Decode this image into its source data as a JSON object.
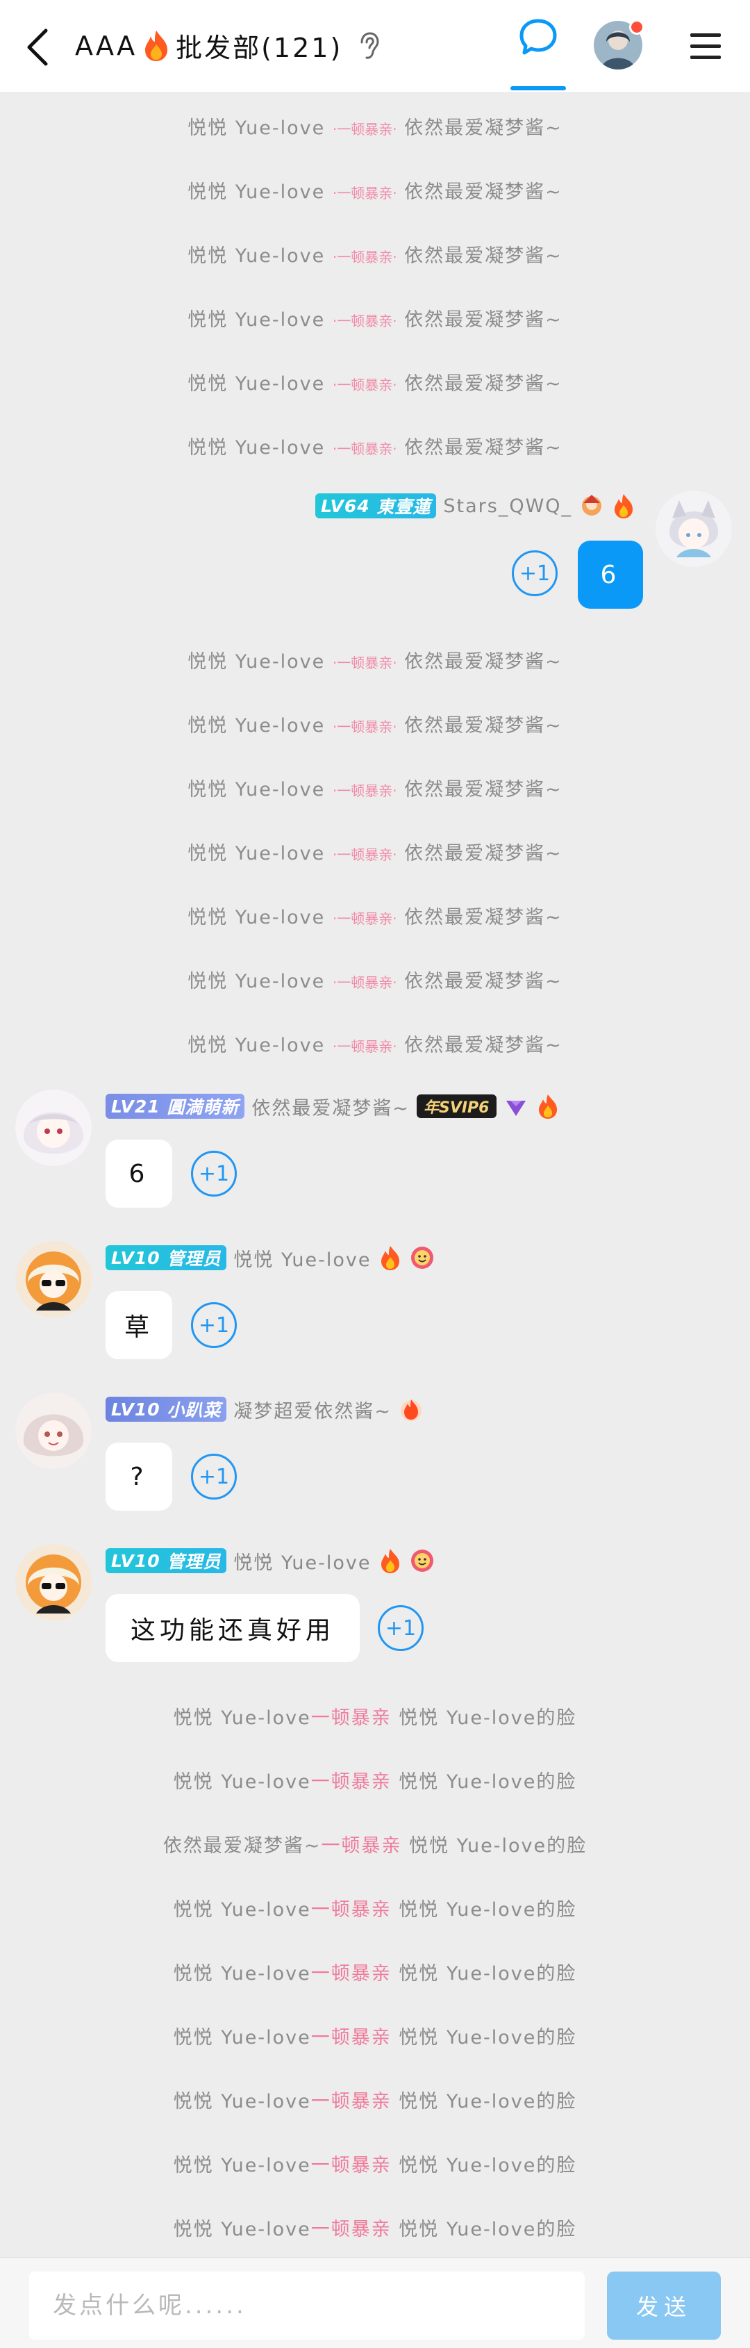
{
  "header": {
    "title_prefix": "AAA",
    "title_suffix": "批发部(121)",
    "icons": [
      "back-icon",
      "fire-icon",
      "ear-icon",
      "chat-bubble-icon",
      "avatar",
      "menu-icon"
    ]
  },
  "notices_top": [
    {
      "a": "悦悦 Yue-love",
      "b": "一顿暴亲",
      "c": "依然最爱凝梦酱~"
    },
    {
      "a": "悦悦 Yue-love",
      "b": "一顿暴亲",
      "c": "依然最爱凝梦酱~"
    },
    {
      "a": "悦悦 Yue-love",
      "b": "一顿暴亲",
      "c": "依然最爱凝梦酱~"
    },
    {
      "a": "悦悦 Yue-love",
      "b": "一顿暴亲",
      "c": "依然最爱凝梦酱~"
    },
    {
      "a": "悦悦 Yue-love",
      "b": "一顿暴亲",
      "c": "依然最爱凝梦酱~"
    },
    {
      "a": "悦悦 Yue-love",
      "b": "一顿暴亲",
      "c": "依然最爱凝梦酱~"
    }
  ],
  "self_message": {
    "level": "LV64",
    "title": "東壹蓮",
    "name": "Stars_QWQ_",
    "text": "6",
    "plus_label": "+1"
  },
  "notices_mid": [
    {
      "a": "悦悦 Yue-love",
      "b": "一顿暴亲",
      "c": "依然最爱凝梦酱~"
    },
    {
      "a": "悦悦 Yue-love",
      "b": "一顿暴亲",
      "c": "依然最爱凝梦酱~"
    },
    {
      "a": "悦悦 Yue-love",
      "b": "一顿暴亲",
      "c": "依然最爱凝梦酱~"
    },
    {
      "a": "悦悦 Yue-love",
      "b": "一顿暴亲",
      "c": "依然最爱凝梦酱~"
    },
    {
      "a": "悦悦 Yue-love",
      "b": "一顿暴亲",
      "c": "依然最爱凝梦酱~"
    },
    {
      "a": "悦悦 Yue-love",
      "b": "一顿暴亲",
      "c": "依然最爱凝梦酱~"
    },
    {
      "a": "悦悦 Yue-love",
      "b": "一顿暴亲",
      "c": "依然最爱凝梦酱~"
    }
  ],
  "messages": [
    {
      "level": "LV21",
      "title": "圓満萌新",
      "name": "依然最爱凝梦酱~",
      "vip": "年SVIP6",
      "text": "6",
      "plus_label": "+1"
    },
    {
      "level": "LV10",
      "title": "管理员",
      "name": "悦悦 Yue-love",
      "text": "草",
      "plus_label": "+1"
    },
    {
      "level": "LV10",
      "title": "小趴菜",
      "name": "凝梦超爱依然酱~",
      "text": "?",
      "plus_label": "+1"
    },
    {
      "level": "LV10",
      "title": "管理员",
      "name": "悦悦 Yue-love",
      "text": "这功能还真好用",
      "plus_label": "+1"
    }
  ],
  "notices_bottom": [
    {
      "a": "悦悦 Yue-love",
      "b": "一顿暴亲",
      "c": "悦悦 Yue-love的脸"
    },
    {
      "a": "悦悦 Yue-love",
      "b": "一顿暴亲",
      "c": "悦悦 Yue-love的脸"
    },
    {
      "a": "依然最爱凝梦酱~",
      "b": "一顿暴亲",
      "c": "悦悦 Yue-love的脸"
    },
    {
      "a": "悦悦 Yue-love",
      "b": "一顿暴亲",
      "c": "悦悦 Yue-love的脸"
    },
    {
      "a": "悦悦 Yue-love",
      "b": "一顿暴亲",
      "c": "悦悦 Yue-love的脸"
    },
    {
      "a": "悦悦 Yue-love",
      "b": "一顿暴亲",
      "c": "悦悦 Yue-love的脸"
    },
    {
      "a": "悦悦 Yue-love",
      "b": "一顿暴亲",
      "c": "悦悦 Yue-love的脸"
    },
    {
      "a": "悦悦 Yue-love",
      "b": "一顿暴亲",
      "c": "悦悦 Yue-love的脸"
    },
    {
      "a": "悦悦 Yue-love",
      "b": "一顿暴亲",
      "c": "悦悦 Yue-love的脸"
    }
  ],
  "input": {
    "placeholder": "发点什么呢......",
    "value": ""
  },
  "send_label": "发送",
  "colors": {
    "accent": "#0a99f6",
    "background": "#ededed",
    "send_disabled": "#89c8f2"
  }
}
